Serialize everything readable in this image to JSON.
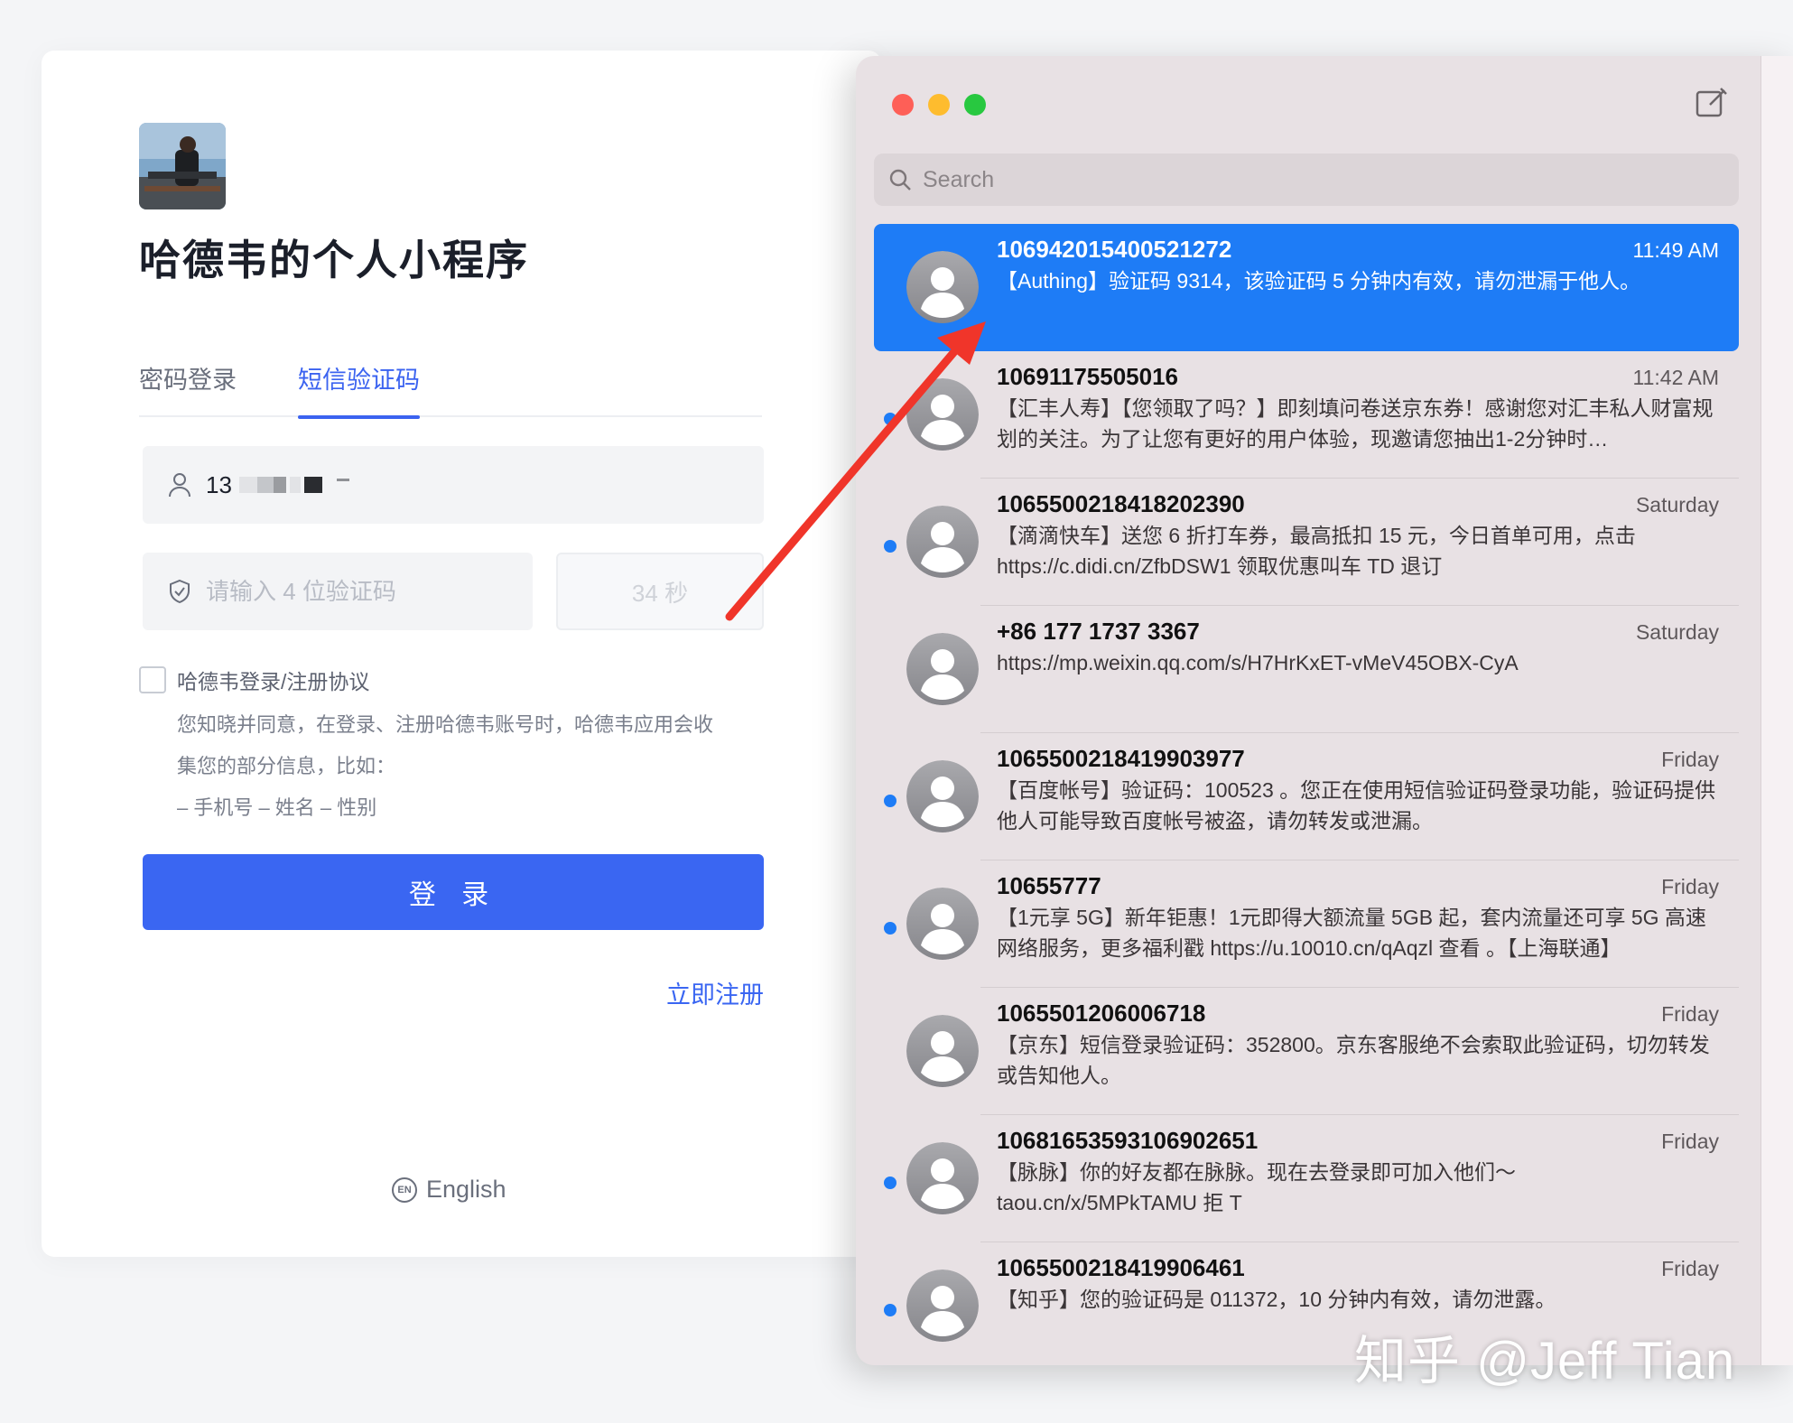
{
  "login": {
    "app_title": "哈德韦的个人小程序",
    "tabs": [
      "密码登录",
      "短信验证码"
    ],
    "phone_value": "13",
    "code_placeholder": "请输入 4 位验证码",
    "countdown": "34 秒",
    "agreement_label": "哈德韦登录/注册协议",
    "agreement_text": [
      "您知晓并同意，在登录、注册哈德韦账号时，哈德韦应用会收",
      "集您的部分信息，比如：",
      "– 手机号 – 姓名 – 性别"
    ],
    "login_button": "登 录",
    "register_link": "立即注册",
    "language": "English",
    "language_badge": "EN"
  },
  "messages": {
    "search_placeholder": "Search",
    "items": [
      {
        "sender": "106942015400521272",
        "time": "11:49 AM",
        "preview": "【Authing】验证码 9314，该验证码 5 分钟内有效，请勿泄漏于他人。",
        "unread": false,
        "selected": true
      },
      {
        "sender": "10691175505016",
        "time": "11:42 AM",
        "preview": "【汇丰人寿】【您领取了吗？】即刻填问卷送京东券！感谢您对汇丰私人财富规划的关注。为了让您有更好的用户体验，现邀请您抽出1-2分钟时…",
        "unread": true,
        "selected": false
      },
      {
        "sender": "1065500218418202390",
        "time": "Saturday",
        "preview": "【滴滴快车】送您 6 折打车券，最高抵扣 15 元，今日首单可用，点击 https://c.didi.cn/ZfbDSW1 领取优惠叫车 TD 退订",
        "unread": true,
        "selected": false
      },
      {
        "sender": "+86 177 1737 3367",
        "time": "Saturday",
        "preview": "https://mp.weixin.qq.com/s/H7HrKxET-vMeV45OBX-CyA",
        "unread": false,
        "selected": false
      },
      {
        "sender": "1065500218419903977",
        "time": "Friday",
        "preview": "【百度帐号】验证码：100523 。您正在使用短信验证码登录功能，验证码提供他人可能导致百度帐号被盗，请勿转发或泄漏。",
        "unread": true,
        "selected": false
      },
      {
        "sender": "10655777",
        "time": "Friday",
        "preview": "【1元享 5G】新年钜惠！1元即得大额流量 5GB 起，套内流量还可享 5G 高速网络服务，更多福利戳 https://u.10010.cn/qAqzl 查看 。【上海联通】",
        "unread": true,
        "selected": false
      },
      {
        "sender": "106550120600​6718",
        "time": "Friday",
        "preview": "【京东】短信登录验证码：352800。京东客服绝不会索取此验证码，切勿转发或告知他人。",
        "unread": false,
        "selected": false
      },
      {
        "sender": "1068165359310690265​1",
        "time": "Friday",
        "preview": "【脉脉】你的好友都在脉脉。现在去登录即可加入他们～ taou.cn/x/5MPkTAMU 拒 T",
        "unread": true,
        "selected": false
      },
      {
        "sender": "1065500218419906461",
        "time": "Friday",
        "preview": "【知乎】您的验证码是 011372，10 分钟内有效，请勿泄露。",
        "unread": true,
        "selected": false
      }
    ]
  },
  "watermark": "知乎 @Jeff Tian",
  "colors": {
    "accent": "#3a66f2",
    "selected": "#1e7cf6",
    "arrow": "#f0352a"
  }
}
